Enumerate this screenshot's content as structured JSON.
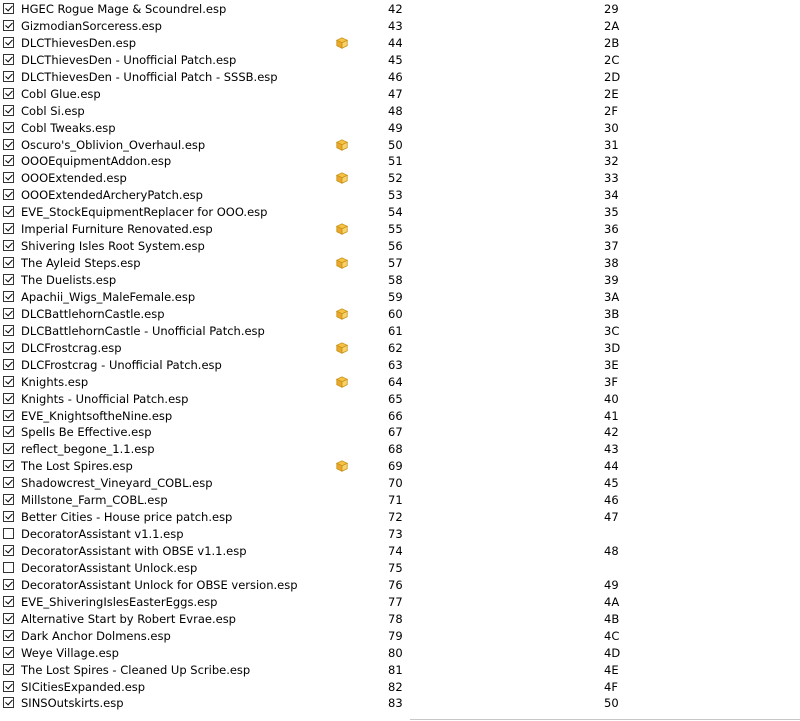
{
  "colors": {
    "flag_fill": "#f5c242",
    "flag_stroke": "#c8901a",
    "checkbox_border": "#333333"
  },
  "icons": {
    "flag": "package-icon"
  },
  "plugins": [
    {
      "name": "HGEC Rogue Mage & Scoundrel.esp",
      "checked": true,
      "flag": false,
      "index": "42",
      "hex": "29"
    },
    {
      "name": "GizmodianSorceress.esp",
      "checked": true,
      "flag": false,
      "index": "43",
      "hex": "2A"
    },
    {
      "name": "DLCThievesDen.esp",
      "checked": true,
      "flag": true,
      "index": "44",
      "hex": "2B"
    },
    {
      "name": "DLCThievesDen - Unofficial Patch.esp",
      "checked": true,
      "flag": false,
      "index": "45",
      "hex": "2C"
    },
    {
      "name": "DLCThievesDen - Unofficial Patch - SSSB.esp",
      "checked": true,
      "flag": false,
      "index": "46",
      "hex": "2D"
    },
    {
      "name": "Cobl Glue.esp",
      "checked": true,
      "flag": false,
      "index": "47",
      "hex": "2E"
    },
    {
      "name": "Cobl Si.esp",
      "checked": true,
      "flag": false,
      "index": "48",
      "hex": "2F"
    },
    {
      "name": "Cobl Tweaks.esp",
      "checked": true,
      "flag": false,
      "index": "49",
      "hex": "30"
    },
    {
      "name": "Oscuro's_Oblivion_Overhaul.esp",
      "checked": true,
      "flag": true,
      "index": "50",
      "hex": "31"
    },
    {
      "name": "OOOEquipmentAddon.esp",
      "checked": true,
      "flag": false,
      "index": "51",
      "hex": "32"
    },
    {
      "name": "OOOExtended.esp",
      "checked": true,
      "flag": true,
      "index": "52",
      "hex": "33"
    },
    {
      "name": "OOOExtendedArcheryPatch.esp",
      "checked": true,
      "flag": false,
      "index": "53",
      "hex": "34"
    },
    {
      "name": "EVE_StockEquipmentReplacer for OOO.esp",
      "checked": true,
      "flag": false,
      "index": "54",
      "hex": "35"
    },
    {
      "name": "Imperial Furniture Renovated.esp",
      "checked": true,
      "flag": true,
      "index": "55",
      "hex": "36"
    },
    {
      "name": "Shivering Isles Root System.esp",
      "checked": true,
      "flag": false,
      "index": "56",
      "hex": "37"
    },
    {
      "name": "The Ayleid Steps.esp",
      "checked": true,
      "flag": true,
      "index": "57",
      "hex": "38"
    },
    {
      "name": "The Duelists.esp",
      "checked": true,
      "flag": false,
      "index": "58",
      "hex": "39"
    },
    {
      "name": "Apachii_Wigs_MaleFemale.esp",
      "checked": true,
      "flag": false,
      "index": "59",
      "hex": "3A"
    },
    {
      "name": "DLCBattlehornCastle.esp",
      "checked": true,
      "flag": true,
      "index": "60",
      "hex": "3B"
    },
    {
      "name": "DLCBattlehornCastle - Unofficial Patch.esp",
      "checked": true,
      "flag": false,
      "index": "61",
      "hex": "3C"
    },
    {
      "name": "DLCFrostcrag.esp",
      "checked": true,
      "flag": true,
      "index": "62",
      "hex": "3D"
    },
    {
      "name": "DLCFrostcrag - Unofficial Patch.esp",
      "checked": true,
      "flag": false,
      "index": "63",
      "hex": "3E"
    },
    {
      "name": "Knights.esp",
      "checked": true,
      "flag": true,
      "index": "64",
      "hex": "3F"
    },
    {
      "name": "Knights - Unofficial Patch.esp",
      "checked": true,
      "flag": false,
      "index": "65",
      "hex": "40"
    },
    {
      "name": "EVE_KnightsoftheNine.esp",
      "checked": true,
      "flag": false,
      "index": "66",
      "hex": "41"
    },
    {
      "name": "Spells Be Effective.esp",
      "checked": true,
      "flag": false,
      "index": "67",
      "hex": "42"
    },
    {
      "name": "reflect_begone_1.1.esp",
      "checked": true,
      "flag": false,
      "index": "68",
      "hex": "43"
    },
    {
      "name": "The Lost Spires.esp",
      "checked": true,
      "flag": true,
      "index": "69",
      "hex": "44"
    },
    {
      "name": "Shadowcrest_Vineyard_COBL.esp",
      "checked": true,
      "flag": false,
      "index": "70",
      "hex": "45"
    },
    {
      "name": "Millstone_Farm_COBL.esp",
      "checked": true,
      "flag": false,
      "index": "71",
      "hex": "46"
    },
    {
      "name": "Better Cities - House price patch.esp",
      "checked": true,
      "flag": false,
      "index": "72",
      "hex": "47"
    },
    {
      "name": "DecoratorAssistant v1.1.esp",
      "checked": false,
      "flag": false,
      "index": "73",
      "hex": ""
    },
    {
      "name": "DecoratorAssistant with OBSE v1.1.esp",
      "checked": true,
      "flag": false,
      "index": "74",
      "hex": "48"
    },
    {
      "name": "DecoratorAssistant Unlock.esp",
      "checked": false,
      "flag": false,
      "index": "75",
      "hex": ""
    },
    {
      "name": "DecoratorAssistant Unlock for OBSE version.esp",
      "checked": true,
      "flag": false,
      "index": "76",
      "hex": "49"
    },
    {
      "name": "EVE_ShiveringIslesEasterEggs.esp",
      "checked": true,
      "flag": false,
      "index": "77",
      "hex": "4A"
    },
    {
      "name": "Alternative Start by Robert Evrae.esp",
      "checked": true,
      "flag": false,
      "index": "78",
      "hex": "4B"
    },
    {
      "name": "Dark Anchor Dolmens.esp",
      "checked": true,
      "flag": false,
      "index": "79",
      "hex": "4C"
    },
    {
      "name": "Weye Village.esp",
      "checked": true,
      "flag": false,
      "index": "80",
      "hex": "4D"
    },
    {
      "name": "The Lost Spires - Cleaned Up Scribe.esp",
      "checked": true,
      "flag": false,
      "index": "81",
      "hex": "4E"
    },
    {
      "name": "SICitiesExpanded.esp",
      "checked": true,
      "flag": false,
      "index": "82",
      "hex": "4F"
    },
    {
      "name": "SINSOutskirts.esp",
      "checked": true,
      "flag": false,
      "index": "83",
      "hex": "50"
    }
  ]
}
